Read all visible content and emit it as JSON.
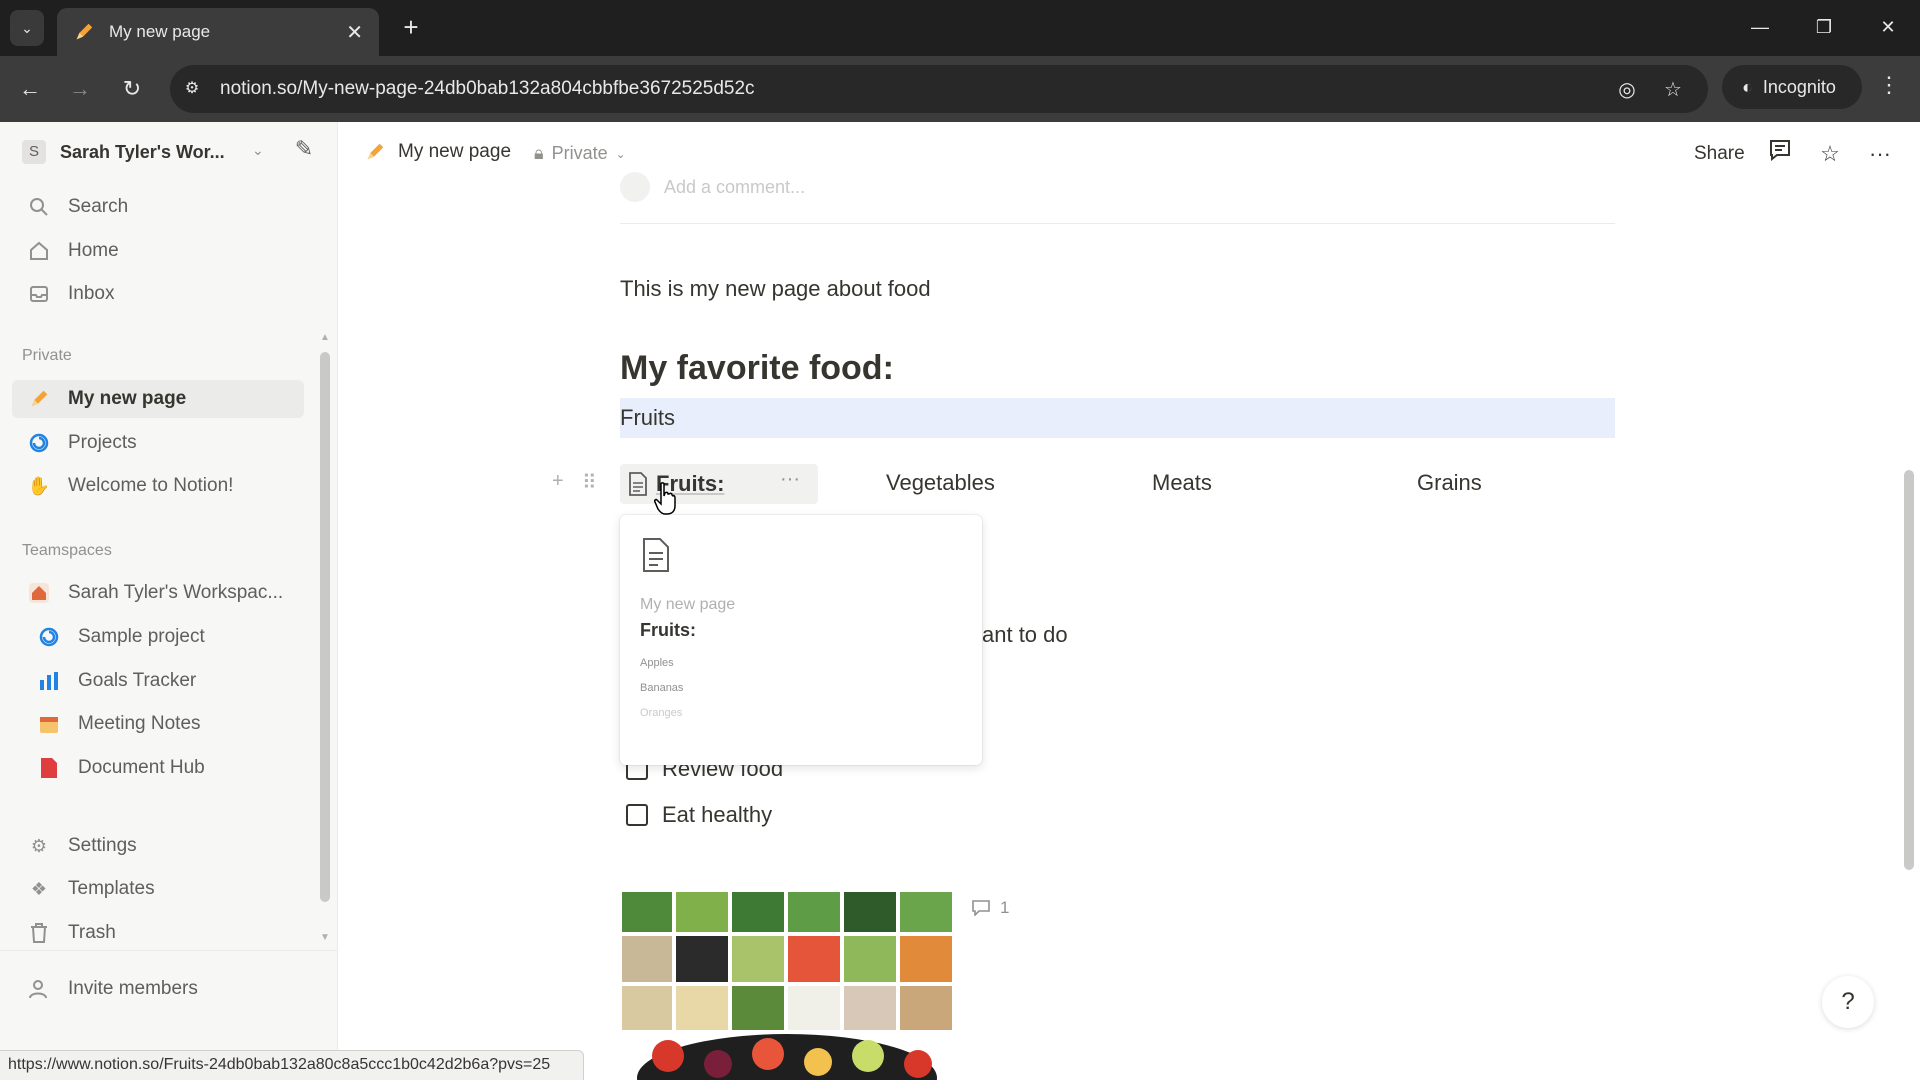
{
  "browser": {
    "tab_title": "My new page",
    "url": "notion.so/My-new-page-24db0bab132a804cbbfbe3672525d52c",
    "incognito_label": "Incognito",
    "status_url": "https://www.notion.so/Fruits-24db0bab132a80c8a5ccc1b0c42d2b6a?pvs=25"
  },
  "sidebar": {
    "workspace_avatar": "S",
    "workspace_name": "Sarah Tyler's Wor...",
    "top_items": [
      {
        "label": "Search",
        "icon": "search-icon"
      },
      {
        "label": "Home",
        "icon": "home-icon"
      },
      {
        "label": "Inbox",
        "icon": "inbox-icon"
      }
    ],
    "private_label": "Private",
    "private_items": [
      {
        "label": "My new page",
        "icon": "pencil-icon",
        "active": true
      },
      {
        "label": "Projects",
        "icon": "projects-icon"
      },
      {
        "label": "Welcome to Notion!",
        "icon": "wave-icon"
      }
    ],
    "teamspaces_label": "Teamspaces",
    "teamspace_name": "Sarah Tyler's Workspac...",
    "teamspace_items": [
      {
        "label": "Sample project",
        "icon": "projects-icon"
      },
      {
        "label": "Goals Tracker",
        "icon": "chart-icon"
      },
      {
        "label": "Meeting Notes",
        "icon": "calendar-icon"
      },
      {
        "label": "Document Hub",
        "icon": "document-icon"
      }
    ],
    "bottom_items": [
      {
        "label": "Settings",
        "icon": "gear-icon"
      },
      {
        "label": "Templates",
        "icon": "templates-icon"
      },
      {
        "label": "Trash",
        "icon": "trash-icon"
      }
    ],
    "invite_label": "Invite members"
  },
  "topbar": {
    "page_title": "My new page",
    "privacy": "Private",
    "share_label": "Share"
  },
  "content": {
    "comment_placeholder": "Add a comment...",
    "intro": "This is my new page about food",
    "heading": "My favorite food:",
    "selected_text": "Fruits",
    "columns": [
      "Fruits:",
      "Vegetables",
      "Meats",
      "Grains"
    ],
    "partial_text": "ant to do",
    "todos": [
      "Review food",
      "Eat healthy"
    ],
    "image_comment_count": "1"
  },
  "hover_card": {
    "parent": "My new page",
    "title": "Fruits:",
    "items": [
      "Apples",
      "Bananas",
      "Oranges"
    ]
  },
  "colors": {
    "accent_blue": "#2383e2",
    "selection": "#e8eefb",
    "sidebar_bg": "#f7f7f5"
  }
}
